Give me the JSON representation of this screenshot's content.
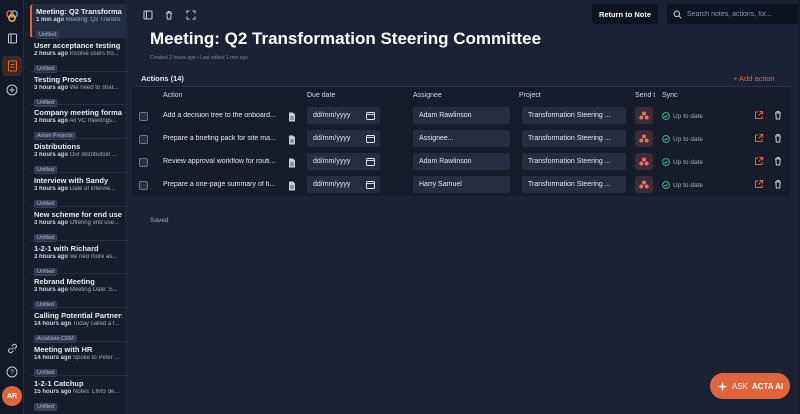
{
  "app": {
    "user_initials": "AR",
    "accent_color": "#e0653a"
  },
  "rail": {
    "icons": [
      "logo-icon",
      "new-note-icon",
      "notes-icon",
      "add-icon",
      "link-icon",
      "help-icon"
    ]
  },
  "notes": [
    {
      "title": "Meeting: Q2 Transformati...",
      "time": "1 min ago",
      "preview": "Meeting: Q2 Transfo...",
      "tag": "Unfiled",
      "active": true
    },
    {
      "title": "User acceptance testing",
      "time": "2 hours ago",
      "preview": "Involve users fro...",
      "tag": "Unfiled"
    },
    {
      "title": "Testing Process",
      "time": "3 hours ago",
      "preview": "We need to shar...",
      "tag": "Unfiled"
    },
    {
      "title": "Company meeting formats",
      "time": "3 hours ago",
      "preview": "All VC meetings...",
      "tag": "Adam Projects"
    },
    {
      "title": "Distributions",
      "time": "3 hours ago",
      "preview": "Our distribution ...",
      "tag": "Unfiled"
    },
    {
      "title": "Interview with Sandy",
      "time": "3 hours ago",
      "preview": "Date of intervie...",
      "tag": "Unfiled"
    },
    {
      "title": "New scheme for end users",
      "time": "3 hours ago",
      "preview": "Offering end use...",
      "tag": "Unfiled"
    },
    {
      "title": "1-2-1 with Richard",
      "time": "3 hours ago",
      "preview": "we ned more as...",
      "tag": "Unfiled"
    },
    {
      "title": "Rebrand Meeting",
      "time": "3 hours ago",
      "preview": "Meeting Date: S...",
      "tag": "Unfiled"
    },
    {
      "title": "Calling Potential Partners",
      "time": "14 hours ago",
      "preview": "Today called a f...",
      "tag": "ActaNote CRM"
    },
    {
      "title": "Meeting with HR",
      "time": "14 hours ago",
      "preview": "Spoke to Peter ...",
      "tag": "Unfiled"
    },
    {
      "title": "1-2-1 Catchup",
      "time": "15 hours ago",
      "preview": "Notes: LIMS de...",
      "tag": "Unfiled"
    }
  ],
  "toolbar": {
    "return_label": "Return to Note",
    "search_placeholder": "Search notes, actions, fol..."
  },
  "page": {
    "title": "Meeting: Q2 Transformation Steering Committee",
    "meta": "Created 2 hours ago • Last edited 1 min ago"
  },
  "actions": {
    "label": "Actions (14)",
    "add_label": "+ Add action",
    "columns": {
      "action": "Action",
      "due": "Due date",
      "assignee": "Assignee",
      "project": "Project",
      "send": "Send t",
      "sync": "Sync"
    },
    "rows": [
      {
        "action": "Add a decision tree to the onboard...",
        "due": "dd/mm/yyyy",
        "assignee": "Adam Rawlinson",
        "project": "Transformation Steering ...",
        "sync": "Up to date"
      },
      {
        "action": "Prepare a briefing pack for site ma...",
        "due": "dd/mm/yyyy",
        "assignee": "Assignee...",
        "project": "Transformation Steering ...",
        "sync": "Up to date"
      },
      {
        "action": "Review approval workflow for routi...",
        "due": "dd/mm/yyyy",
        "assignee": "Adam Rawlinson",
        "project": "Transformation Steering ...",
        "sync": "Up to date"
      },
      {
        "action": "Prepare a one-page summary of fi...",
        "due": "dd/mm/yyyy",
        "assignee": "Harry Samuel",
        "project": "Transformation Steering ...",
        "sync": "Up to date"
      }
    ]
  },
  "status": {
    "saved": "Saved"
  },
  "ask": {
    "prefix": "ASK",
    "brand": "ACTA AI"
  }
}
